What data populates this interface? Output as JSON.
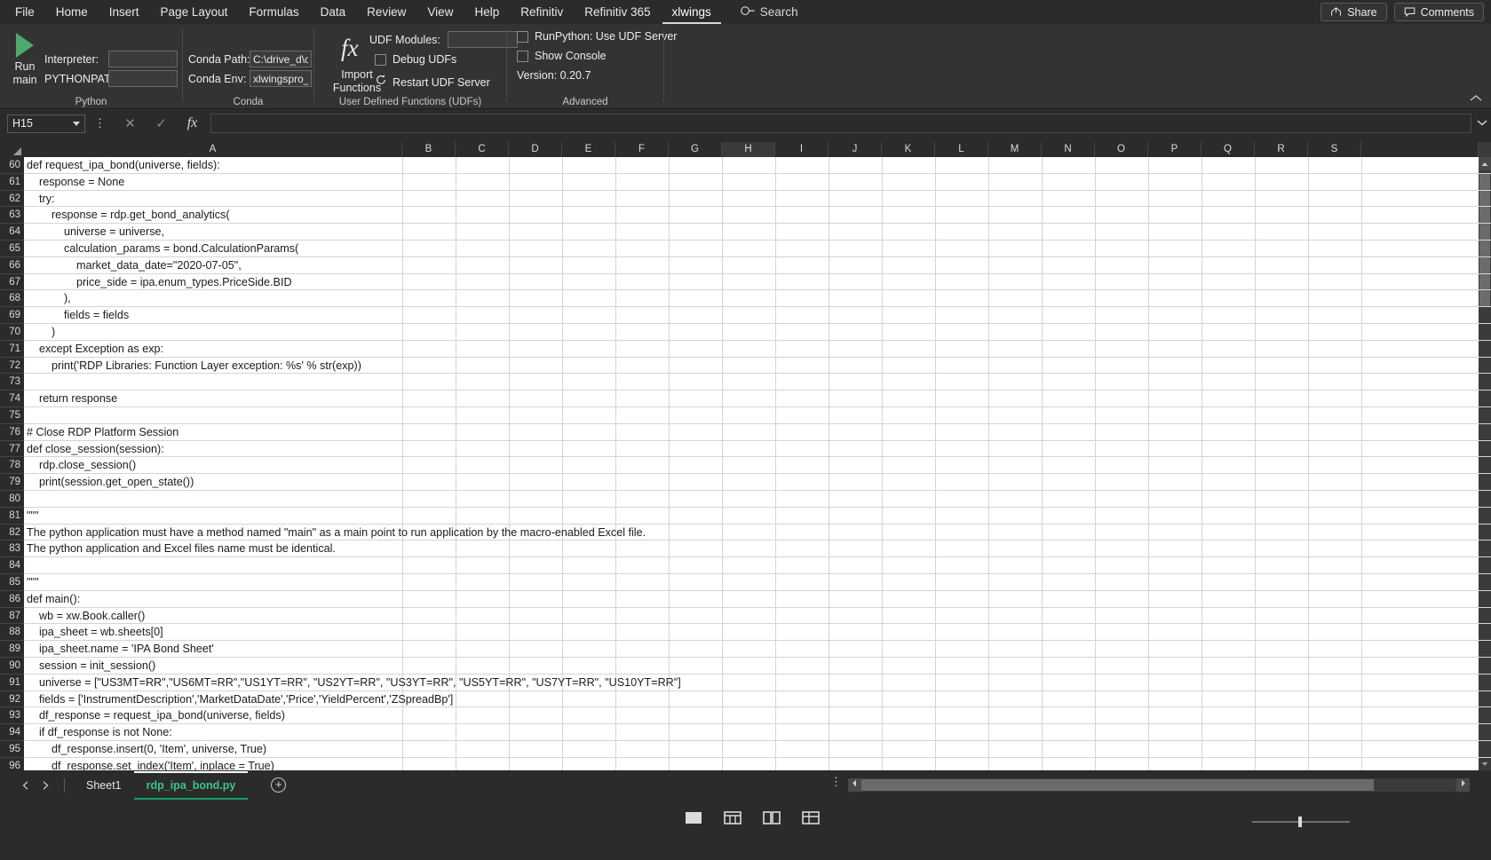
{
  "window": {
    "app": "Microsoft Excel",
    "theme_bg": "#2b2b2b",
    "accent": "#16a06a"
  },
  "menubar": {
    "items": [
      {
        "label": "File",
        "active": false
      },
      {
        "label": "Home",
        "active": false
      },
      {
        "label": "Insert",
        "active": false
      },
      {
        "label": "Page Layout",
        "active": false
      },
      {
        "label": "Formulas",
        "active": false
      },
      {
        "label": "Data",
        "active": false
      },
      {
        "label": "Review",
        "active": false
      },
      {
        "label": "View",
        "active": false
      },
      {
        "label": "Help",
        "active": false
      },
      {
        "label": "Refinitiv",
        "active": false
      },
      {
        "label": "Refinitiv 365",
        "active": false
      },
      {
        "label": "xlwings",
        "active": true
      }
    ],
    "search_label": "Search",
    "share_label": "Share",
    "comments_label": "Comments"
  },
  "ribbon": {
    "groups": [
      {
        "name": "python",
        "label": "Python"
      },
      {
        "name": "conda",
        "label": "Conda"
      },
      {
        "name": "udf",
        "label": "User Defined Functions (UDFs)"
      },
      {
        "name": "advanced",
        "label": "Advanced"
      }
    ],
    "python": {
      "run_main_line1": "Run",
      "run_main_line2": "main",
      "interpreter_label": "Interpreter:",
      "interpreter_value": "",
      "pythonpath_label": "PYTHONPATH:",
      "pythonpath_value": ""
    },
    "conda": {
      "conda_path_label": "Conda Path:",
      "conda_path_value": "C:\\drive_d\\co",
      "conda_env_label": "Conda Env:",
      "conda_env_value": "xlwingspro_rd"
    },
    "udf": {
      "import_functions_line1": "Import",
      "import_functions_line2": "Functions",
      "udf_modules_label": "UDF Modules:",
      "udf_modules_value": "",
      "debug_udfs_label": "Debug UDFs",
      "debug_udfs_checked": false,
      "restart_udf_server_label": "Restart UDF Server"
    },
    "advanced": {
      "runpython_label": "RunPython: Use UDF Server",
      "runpython_checked": false,
      "show_console_label": "Show Console",
      "show_console_checked": false,
      "version_label": "Version: 0.20.7"
    }
  },
  "formula_bar": {
    "name_box_value": "H15",
    "cancel_icon": "✕",
    "enter_icon": "✓",
    "fx_icon": "fx",
    "formula_value": "",
    "expand_icon": "⌄"
  },
  "grid": {
    "columns": [
      "A",
      "B",
      "C",
      "D",
      "E",
      "F",
      "G",
      "H",
      "I",
      "J",
      "K",
      "L",
      "M",
      "N",
      "O",
      "P",
      "Q",
      "R",
      "S"
    ],
    "selected_column": "H",
    "first_row_number": 60,
    "row_count": 37,
    "rows": [
      {
        "num": 60,
        "text": "def request_ipa_bond(universe, fields):"
      },
      {
        "num": 61,
        "text": "    response = None"
      },
      {
        "num": 62,
        "text": "    try:"
      },
      {
        "num": 63,
        "text": "        response = rdp.get_bond_analytics("
      },
      {
        "num": 64,
        "text": "            universe = universe,"
      },
      {
        "num": 65,
        "text": "            calculation_params = bond.CalculationParams("
      },
      {
        "num": 66,
        "text": "                market_data_date=\"2020-07-05\","
      },
      {
        "num": 67,
        "text": "                price_side = ipa.enum_types.PriceSide.BID"
      },
      {
        "num": 68,
        "text": "            ),"
      },
      {
        "num": 69,
        "text": "            fields = fields"
      },
      {
        "num": 70,
        "text": "        )"
      },
      {
        "num": 71,
        "text": "    except Exception as exp:"
      },
      {
        "num": 72,
        "text": "        print('RDP Libraries: Function Layer exception: %s' % str(exp))"
      },
      {
        "num": 73,
        "text": ""
      },
      {
        "num": 74,
        "text": "    return response"
      },
      {
        "num": 75,
        "text": ""
      },
      {
        "num": 76,
        "text": "# Close RDP Platform Session"
      },
      {
        "num": 77,
        "text": "def close_session(session):"
      },
      {
        "num": 78,
        "text": "    rdp.close_session()"
      },
      {
        "num": 79,
        "text": "    print(session.get_open_state())"
      },
      {
        "num": 80,
        "text": ""
      },
      {
        "num": 81,
        "text": "\"\"\""
      },
      {
        "num": 82,
        "text": "The python application must have a method named \"main\" as a main point to run application by the macro-enabled Excel file."
      },
      {
        "num": 83,
        "text": "The python application and Excel files name must be identical."
      },
      {
        "num": 84,
        "text": ""
      },
      {
        "num": 85,
        "text": "\"\"\""
      },
      {
        "num": 86,
        "text": "def main():"
      },
      {
        "num": 87,
        "text": "    wb = xw.Book.caller()"
      },
      {
        "num": 88,
        "text": "    ipa_sheet = wb.sheets[0]"
      },
      {
        "num": 89,
        "text": "    ipa_sheet.name = 'IPA Bond Sheet'"
      },
      {
        "num": 90,
        "text": "    session = init_session()"
      },
      {
        "num": 91,
        "text": "    universe = [\"US3MT=RR\",\"US6MT=RR\",\"US1YT=RR\", \"US2YT=RR\", \"US3YT=RR\", \"US5YT=RR\", \"US7YT=RR\", \"US10YT=RR\"]"
      },
      {
        "num": 92,
        "text": "    fields = ['InstrumentDescription','MarketDataDate','Price','YieldPercent','ZSpreadBp']"
      },
      {
        "num": 93,
        "text": "    df_response = request_ipa_bond(universe, fields)"
      },
      {
        "num": 94,
        "text": "    if df_response is not None:"
      },
      {
        "num": 95,
        "text": "        df_response.insert(0, 'Item', universe, True)"
      },
      {
        "num": 96,
        "text": "        df_response.set_index('Item', inplace = True)"
      }
    ]
  },
  "sheet_tabs": {
    "prev_icon": "◀",
    "next_icon": "▶",
    "tabs": [
      {
        "label": "Sheet1",
        "active": false
      },
      {
        "label": "rdp_ipa_bond.py",
        "active": true
      }
    ],
    "add_sheet_icon": "+"
  }
}
